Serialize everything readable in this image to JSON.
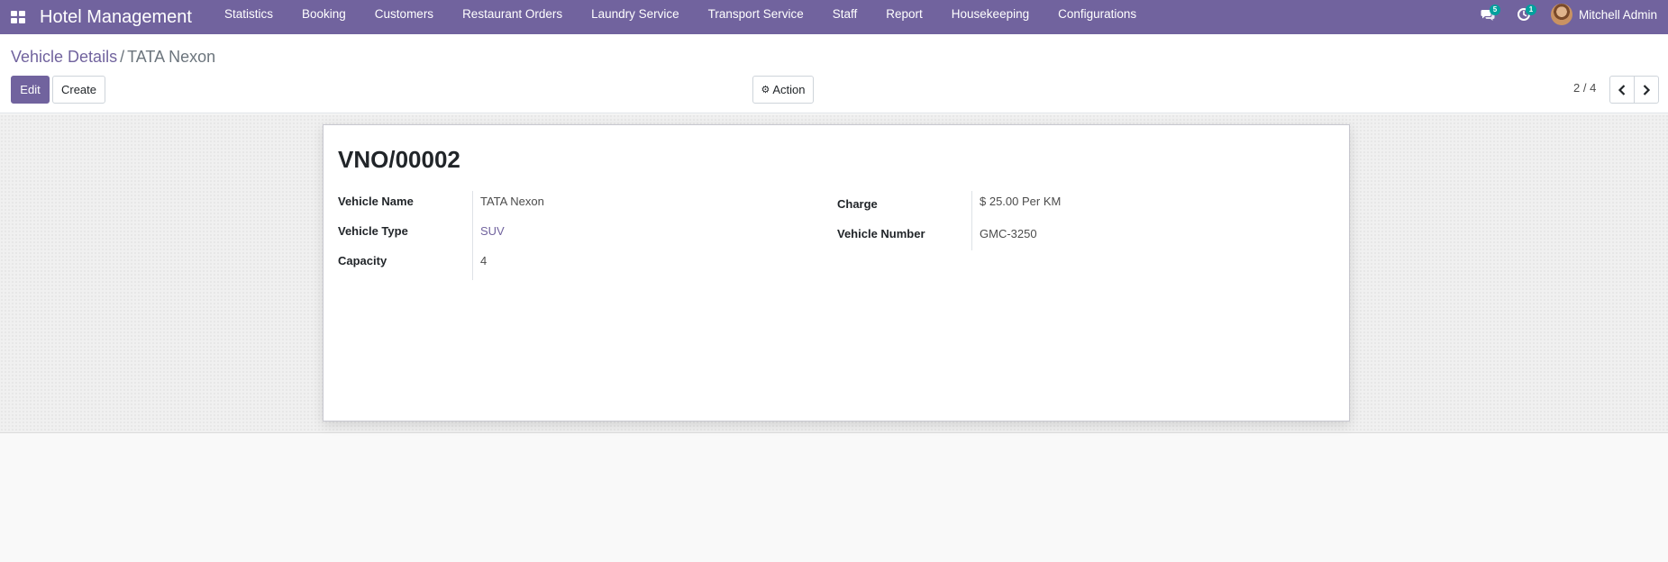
{
  "navbar": {
    "app_title": "Hotel Management",
    "menu": [
      {
        "label": "Statistics"
      },
      {
        "label": "Booking"
      },
      {
        "label": "Customers"
      },
      {
        "label": "Restaurant Orders"
      },
      {
        "label": "Laundry Service"
      },
      {
        "label": "Transport Service"
      },
      {
        "label": "Staff"
      },
      {
        "label": "Report"
      },
      {
        "label": "Housekeeping"
      },
      {
        "label": "Configurations"
      }
    ],
    "messages_count": "5",
    "activities_count": "1",
    "user_name": "Mitchell Admin",
    "accent_color": "#71639e",
    "badge_color": "#00a09d"
  },
  "breadcrumb": {
    "parent": "Vehicle Details",
    "separator": "/",
    "current": "TATA Nexon"
  },
  "buttons": {
    "edit": "Edit",
    "create": "Create",
    "action": "Action"
  },
  "pager": {
    "value": "2 / 4"
  },
  "record": {
    "title": "VNO/00002",
    "left_fields": [
      {
        "label": "Vehicle Name",
        "value": "TATA Nexon"
      },
      {
        "label": "Vehicle Type",
        "value": "SUV"
      },
      {
        "label": "Capacity",
        "value": "4"
      }
    ],
    "right_fields": [
      {
        "label": "Charge",
        "value": "$ 25.00 Per KM"
      },
      {
        "label": "Vehicle Number",
        "value": "GMC-3250"
      }
    ]
  }
}
